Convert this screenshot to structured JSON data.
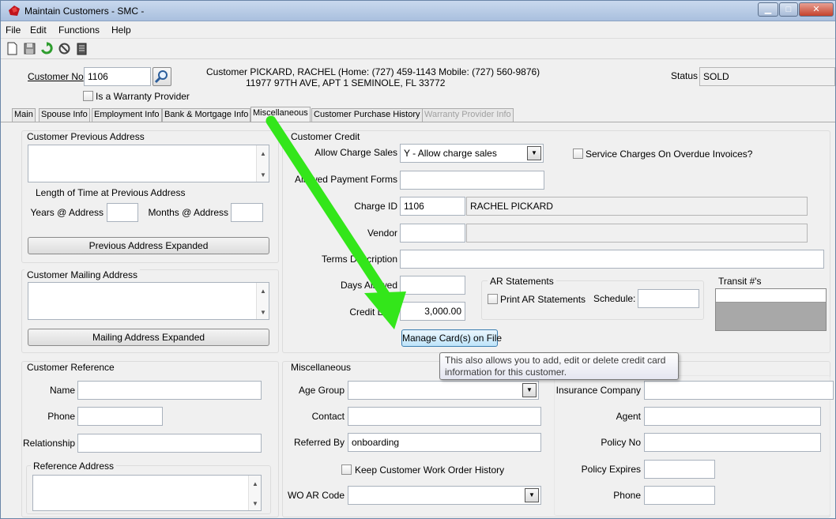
{
  "window": {
    "title": "Maintain Customers - SMC -"
  },
  "menu": [
    "File",
    "Edit",
    "Functions",
    "Help"
  ],
  "toolbar_icons": [
    "new-document-icon",
    "save-icon",
    "refresh-icon",
    "cancel-icon",
    "delete-icon"
  ],
  "header": {
    "customer_no_label": "Customer No",
    "customer_no_value": "1106",
    "warranty_provider_label": "Is a Warranty Provider",
    "customer_info_line1": "Customer PICKARD, RACHEL  (Home: (727) 459-1143  Mobile: (727) 560-9876)",
    "customer_info_line2": "11977 97TH AVE, APT 1 SEMINOLE, FL 33772",
    "status_label": "Status",
    "status_value": "SOLD"
  },
  "tabs": [
    "Main",
    "Spouse Info",
    "Employment Info",
    "Bank & Mortgage Info",
    "Miscellaneous",
    "Customer Purchase History",
    "Warranty Provider Info"
  ],
  "left": {
    "prev_address_title": "Customer Previous Address",
    "length_title": "Length of Time at Previous Address",
    "years_label": "Years @ Address",
    "months_label": "Months @ Address",
    "prev_expanded_button": "Previous Address Expanded",
    "mailing_title": "Customer Mailing Address",
    "mailing_expanded_button": "Mailing Address Expanded"
  },
  "credit": {
    "title": "Customer Credit",
    "allow_charge_label": "Allow Charge Sales",
    "allow_charge_value": "Y - Allow charge sales",
    "service_charges_label": "Service Charges On Overdue Invoices?",
    "allowed_payment_label": "Allowed Payment Forms",
    "charge_id_label": "Charge ID",
    "charge_id_value": "1106",
    "charge_name_value": "RACHEL PICKARD",
    "vendor_label": "Vendor",
    "terms_label": "Terms Description",
    "days_label": "Days Allowed",
    "credit_limit_label": "Credit Limit",
    "credit_limit_value": "3,000.00",
    "ar_title": "AR Statements",
    "print_ar_label": "Print AR Statements",
    "schedule_label": "Schedule:",
    "transit_label": "Transit #'s",
    "manage_cards_button": "Manage Card(s) on File",
    "tooltip": "This also allows you to add, edit or delete credit card information for this customer."
  },
  "reference": {
    "title": "Customer Reference",
    "name_label": "Name",
    "phone_label": "Phone",
    "relationship_label": "Relationship",
    "address_title": "Reference Address"
  },
  "misc": {
    "title": "Miscellaneous",
    "age_group_label": "Age Group",
    "contact_label": "Contact",
    "referred_by_label": "Referred By",
    "referred_by_value": "onboarding",
    "keep_history_label": "Keep Customer Work Order History",
    "wo_ar_code_label": "WO AR Code",
    "insurance_company_label": "Insurance Company",
    "agent_label": "Agent",
    "policy_no_label": "Policy No",
    "policy_expires_label": "Policy Expires",
    "phone_label": "Phone"
  },
  "colors": {
    "arrow": "#33e61a",
    "titlebar": "#b8cce6",
    "tooltip_border": "#767676"
  }
}
